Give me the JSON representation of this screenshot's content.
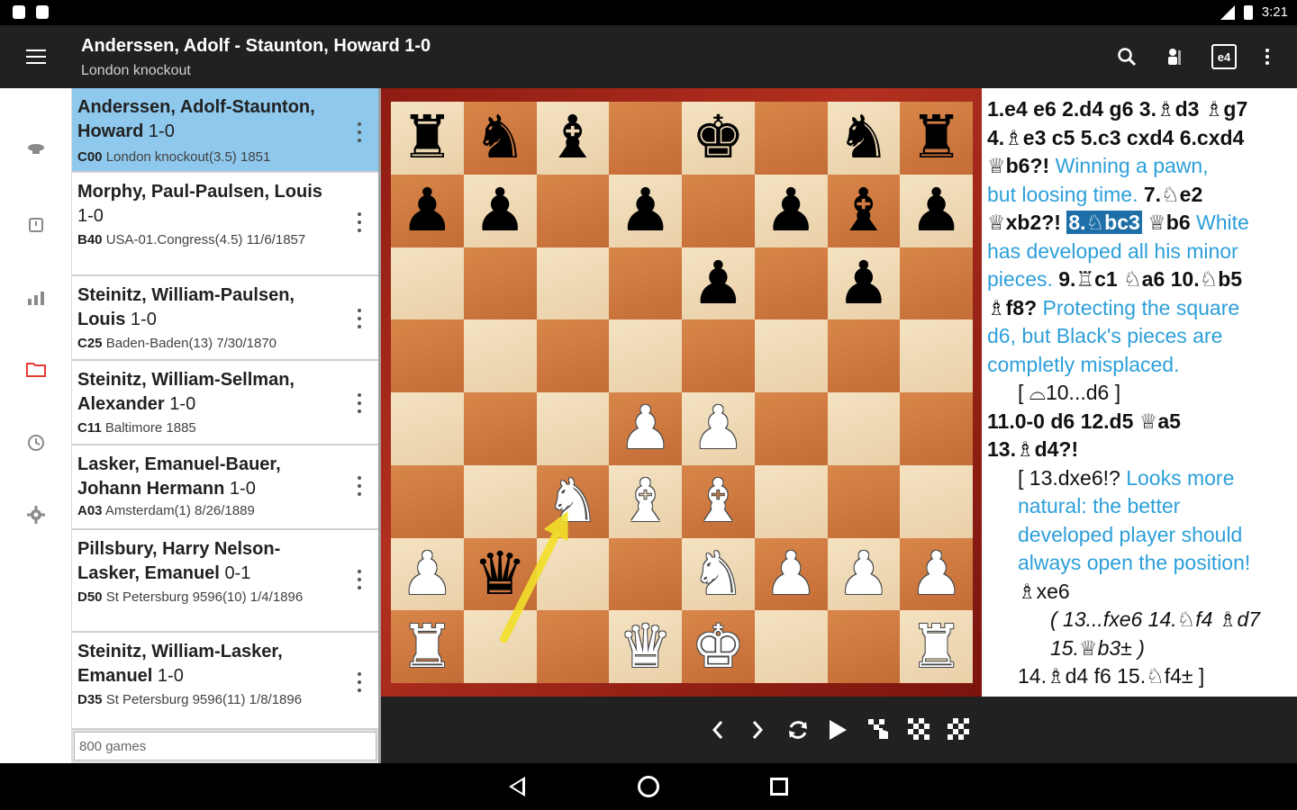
{
  "status": {
    "time": "3:21"
  },
  "toolbar": {
    "title": "Anderssen, Adolf - Staunton, Howard 1-0",
    "subtitle": "London knockout",
    "engine_label": "e4"
  },
  "games": [
    {
      "title": "Anderssen, Adolf-Staunton, Howard",
      "result": "1-0",
      "eco": "C00",
      "meta": "London knockout(3.5) 1851",
      "selected": true
    },
    {
      "title": "Morphy, Paul-Paulsen, Louis",
      "result": "1-0",
      "eco": "B40",
      "meta": "USA-01.Congress(4.5) 11/6/1857"
    },
    {
      "title": "Steinitz, William-Paulsen, Louis",
      "result": "1-0",
      "eco": "C25",
      "meta": "Baden-Baden(13) 7/30/1870"
    },
    {
      "title": "Steinitz, William-Sellman, Alexander",
      "result": "1-0",
      "eco": "C11",
      "meta": "Baltimore 1885"
    },
    {
      "title": "Lasker, Emanuel-Bauer, Johann Hermann",
      "result": "1-0",
      "eco": "A03",
      "meta": "Amsterdam(1) 8/26/1889"
    },
    {
      "title": "Pillsbury, Harry Nelson-Lasker, Emanuel",
      "result": "0-1",
      "eco": "D50",
      "meta": "St Petersburg 9596(10) 1/4/1896"
    },
    {
      "title": "Steinitz, William-Lasker, Emanuel",
      "result": "1-0",
      "eco": "D35",
      "meta": "St Petersburg 9596(11) 1/8/1896"
    }
  ],
  "games_count": "800 games",
  "board": {
    "rows": [
      [
        "r",
        "n",
        "b",
        "",
        "k",
        "",
        "n",
        "r"
      ],
      [
        "p",
        "p",
        "",
        "p",
        "",
        "p",
        "b",
        "p"
      ],
      [
        "",
        "",
        "",
        "",
        "p",
        "",
        "p",
        ""
      ],
      [
        "",
        "",
        "",
        "",
        "",
        "",
        "",
        ""
      ],
      [
        "",
        "",
        "",
        "P",
        "P",
        "",
        "",
        ""
      ],
      [
        "",
        "",
        "N",
        "B",
        "B",
        "",
        "",
        ""
      ],
      [
        "P",
        "q",
        "",
        "",
        "N",
        "P",
        "P",
        "P"
      ],
      [
        "R",
        "",
        "",
        "Q",
        "K",
        "",
        "",
        "R"
      ]
    ],
    "light_color": "#efdbb8",
    "dark_color": "#cf7a40",
    "arrow": {
      "from": "b1",
      "to": "c3",
      "color": "#f2e02a"
    }
  },
  "notation": {
    "l1": "1.e4 e6 2.d4 g6 3.♗d3 ♗g7",
    "l2": "4.♗e3 c5 5.c3 cxd4 6.cxd4",
    "l3": "♕b6?!",
    "l3c": "Winning a pawn,",
    "l4c": "but loosing time.",
    "l4": "7.♘e2",
    "l5a": "♕xb2?!",
    "l5hl": "8.♘bc3",
    "l5b": "♕b6",
    "l5c": "White",
    "l6c": "has developed all his minor",
    "l7c": "pieces.",
    "l7": "9.♖c1 ♘a6 10.♘b5",
    "l8": "♗f8?",
    "l8c": "Protecting the square",
    "l9c": "d6, but Black's pieces are",
    "l10c": "completly misplaced.",
    "l11": "[ ⌓10...d6 ]",
    "l12": "11.0-0 d6 12.d5 ♕a5",
    "l13": "13.♗d4?!",
    "l14a": "[ 13.dxe6!?",
    "l14c": "Looks more",
    "l15c": "natural: the better",
    "l16c": "developed player should",
    "l17c": "always open the position!",
    "l18": "♗xe6",
    "l19": "( 13...fxe6 14.♘f4 ♗d7",
    "l20": "15.♕b3± )",
    "l21": "14.♗d4 f6 15.♘f4± ]"
  }
}
